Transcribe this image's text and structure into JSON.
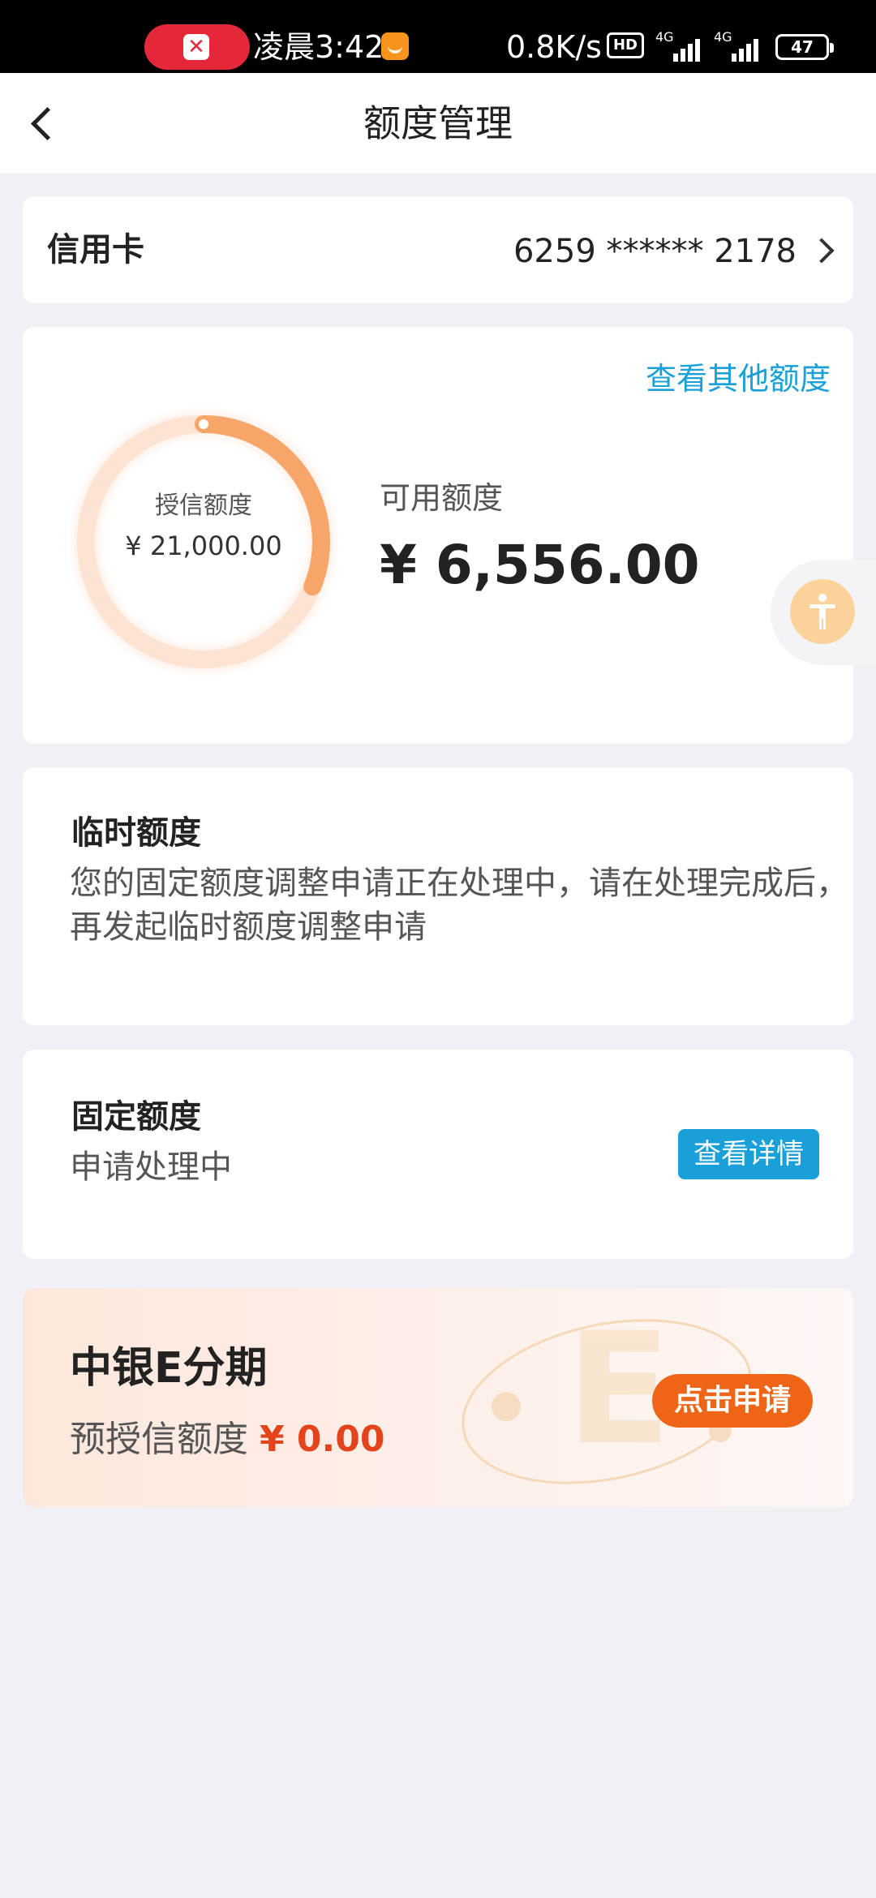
{
  "status_bar": {
    "time": "凌晨3:42",
    "net_speed": "0.8K/s",
    "hd": "HD",
    "signal_1": "4G",
    "signal_2": "4G",
    "battery": "47"
  },
  "nav": {
    "title": "额度管理"
  },
  "credit_card": {
    "label": "信用卡",
    "number": "6259 ****** 2178"
  },
  "limit": {
    "view_other": "查看其他额度",
    "granted_label": "授信额度",
    "granted_value": "¥ 21,000.00",
    "available_label": "可用额度",
    "available_value": "¥ 6,556.00",
    "available_fraction": 0.312
  },
  "temp_limit": {
    "title": "临时额度",
    "desc": "您的固定额度调整申请正在处理中，请在处理完成后，再发起临时额度调整申请"
  },
  "fixed_limit": {
    "title": "固定额度",
    "status": "申请处理中",
    "button": "查看详情"
  },
  "installment": {
    "title": "中银E分期",
    "pre_label": "预授信额度",
    "pre_amount": "¥ 0.00",
    "button": "点击申请"
  },
  "colors": {
    "accent_blue": "#1aa0d8",
    "accent_orange": "#ee6518",
    "amount_red": "#e4441b",
    "ring_track": "#fde3d2",
    "ring_fill": "#f8a56a"
  }
}
